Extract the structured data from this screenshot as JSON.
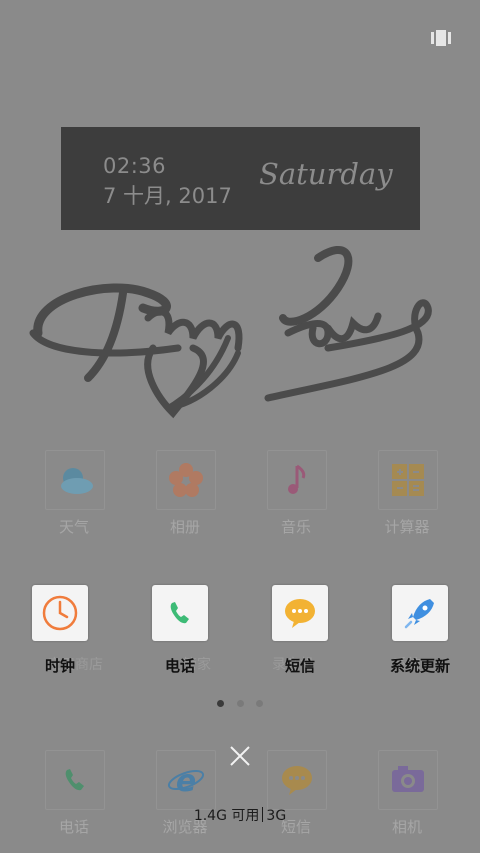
{
  "clock": {
    "time": "02:36",
    "date": "7 十月, 2017",
    "weekday": "Saturday"
  },
  "wallpaper": {
    "text": "True Love"
  },
  "background_apps": [
    {
      "label": "天气",
      "icon": "weather-icon"
    },
    {
      "label": "相册",
      "icon": "gallery-icon"
    },
    {
      "label": "音乐",
      "icon": "music-icon"
    },
    {
      "label": "计算器",
      "icon": "calculator-icon"
    }
  ],
  "ghost_labels": [
    "应用商店",
    "管家",
    "录音机",
    "系统"
  ],
  "recent_apps": [
    {
      "label": "时钟",
      "icon": "clock-icon"
    },
    {
      "label": "电话",
      "icon": "phone-icon"
    },
    {
      "label": "短信",
      "icon": "message-icon"
    },
    {
      "label": "系统更新",
      "icon": "rocket-icon"
    }
  ],
  "dock": [
    {
      "label": "电话",
      "icon": "phone-icon"
    },
    {
      "label": "浏览器",
      "icon": "browser-icon"
    },
    {
      "label": "短信",
      "icon": "message-icon"
    },
    {
      "label": "相机",
      "icon": "camera-icon"
    }
  ],
  "memory": {
    "available": "1.4G 可用",
    "total": "3G"
  },
  "page_indicator": {
    "pages": 3,
    "active": 1
  },
  "colors": {
    "overlay": "#8a8a8a",
    "widget": "#3d3d3d",
    "accent_orange": "#f07c3c",
    "accent_green": "#3dbb76",
    "accent_yellow": "#f2b233",
    "accent_blue": "#3f8fe0"
  }
}
